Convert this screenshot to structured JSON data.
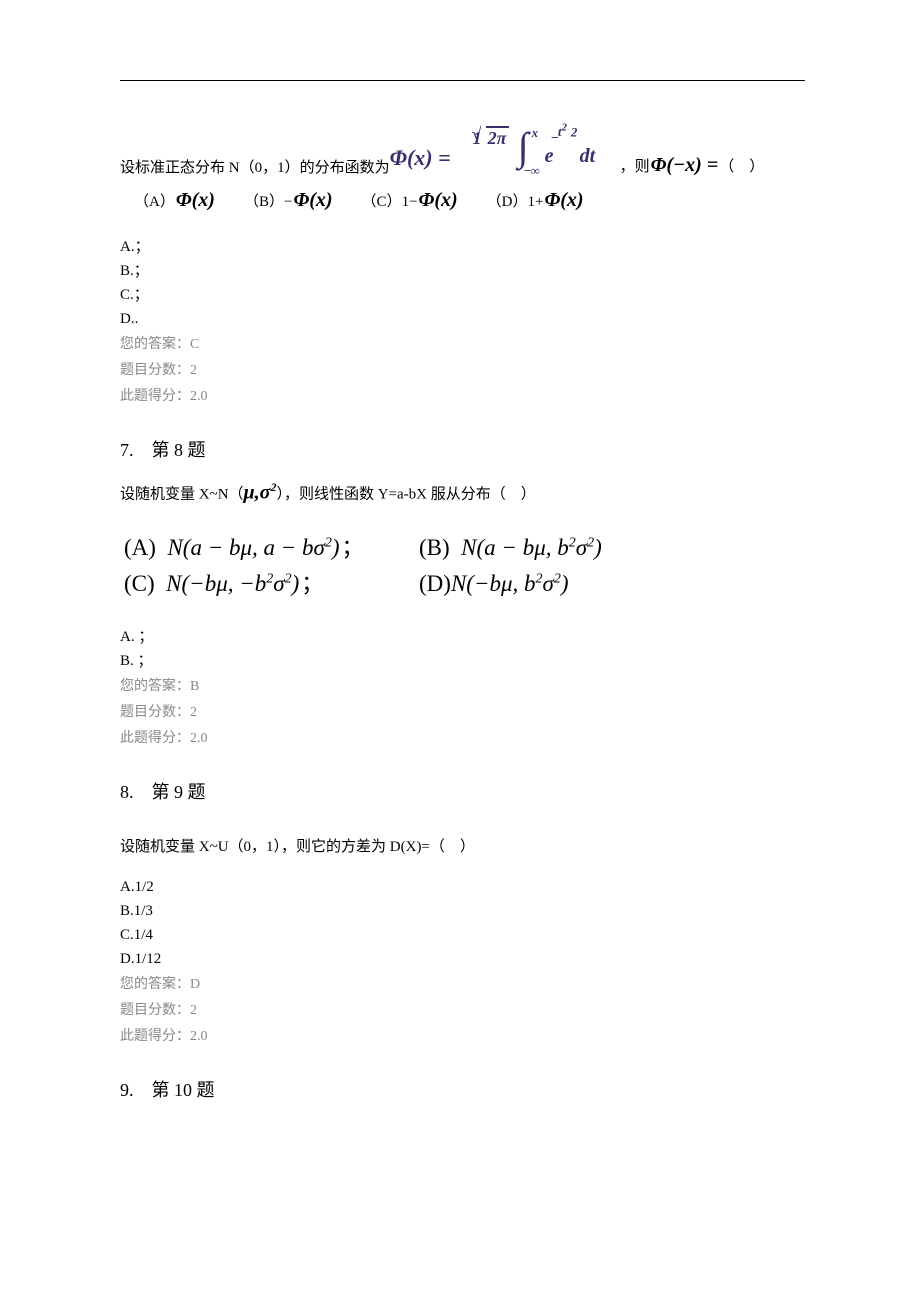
{
  "q6": {
    "pre_text": "设标准正态分布 N（0，1）的分布函数为",
    "post_text_a": "，则",
    "post_phi_arg": "Φ(−x) =",
    "post_text_b": "（ ）",
    "formula_lhs": "Φ(x) =",
    "frac_num": "1",
    "frac_den": "2π",
    "int_upper": "x",
    "int_lower": "−∞",
    "e": "e",
    "exp_num": "t",
    "exp_sup": "2",
    "exp_den": "2",
    "dt": "dt",
    "opts": {
      "a_label": "（A）",
      "a_val": "Φ(x)",
      "b_label": "（B）",
      "b_val_pre": "−",
      "b_val": "Φ(x)",
      "c_label": "（C）",
      "c_val_pre": "1−",
      "c_val": "Φ(x)",
      "d_label": "（D）",
      "d_val_pre": "1+",
      "d_val": "Φ(x)"
    },
    "simple": {
      "a": "A.；",
      "b": "B.；",
      "c": "C.；",
      "d": "D.."
    },
    "answer": "您的答案：C",
    "max": "题目分数：2",
    "score": "此题得分：2.0"
  },
  "q7": {
    "heading": "7. 第 8 题",
    "pre": "设随机变量 X~N（",
    "musigma": "μ,σ",
    "sup": "2",
    "post": "），则线性函数 Y=a-bX 服从分布（ ）",
    "rowA": {
      "lbl": "(A) ",
      "body": "N(a − bμ, a − bσ",
      "sup": "2",
      "close": ")",
      "sep": "；"
    },
    "rowB": {
      "lbl": "(B) ",
      "body": "N(a − bμ, b",
      "sup1": "2",
      "mid": "σ",
      "sup2": "2",
      "close": ")"
    },
    "rowC": {
      "lbl": "(C) ",
      "body": "N(−bμ, −b",
      "sup1": "2",
      "mid": "σ",
      "sup2": "2",
      "close": ")",
      "sep": "；"
    },
    "rowD": {
      "lbl": "(D)",
      "body": "N(−bμ, b",
      "sup1": "2",
      "mid": "σ",
      "sup2": "2",
      "close": ")"
    },
    "simple": {
      "a": "A. ；",
      "b": "B. ；"
    },
    "answer": "您的答案：B",
    "max": "题目分数：2",
    "score": "此题得分：2.0"
  },
  "q8": {
    "heading": "8. 第 9 题",
    "stem": "设随机变量 X~U（0，1），则它的方差为 D(X)=（ ）",
    "opts": {
      "a": "A.1/2",
      "b": "B.1/3",
      "c": "C.1/4",
      "d": "D.1/12"
    },
    "answer": "您的答案：D",
    "max": "题目分数：2",
    "score": "此题得分：2.0"
  },
  "q9": {
    "heading": "9. 第 10 题"
  }
}
